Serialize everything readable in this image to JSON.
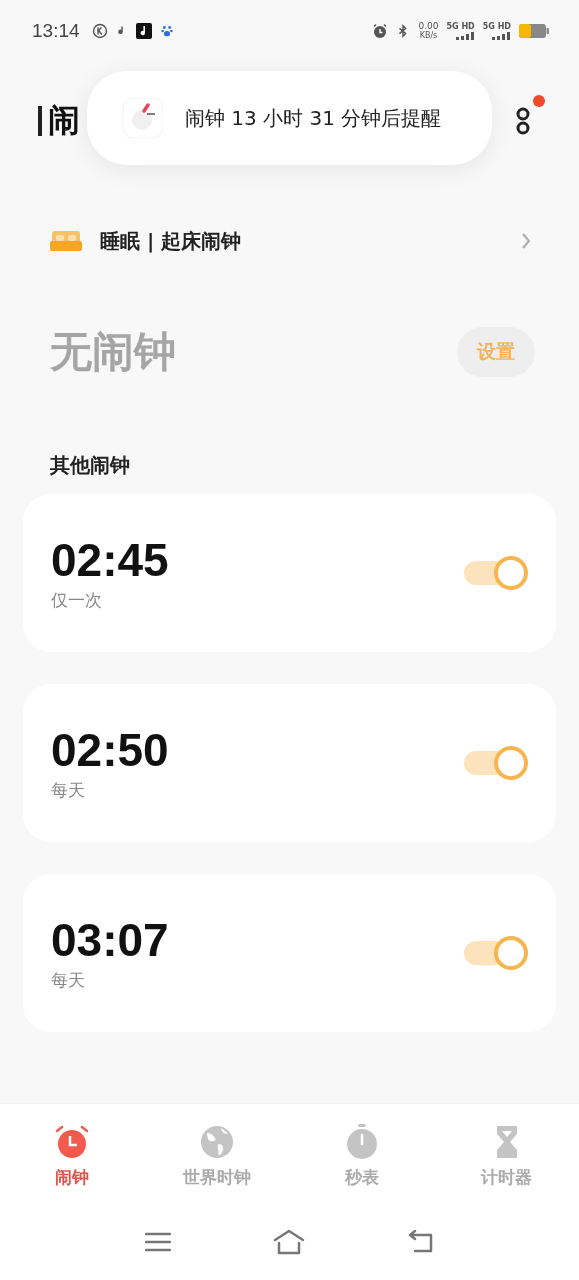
{
  "status_bar": {
    "time": "13:14",
    "net_speed": "0.00",
    "net_unit": "KB/s",
    "sim_labels": [
      "5G HD",
      "5G HD"
    ]
  },
  "header": {
    "title": "闹"
  },
  "toast": {
    "text": "闹钟 13 小时 31 分钟后提醒"
  },
  "menu": {
    "badge": true
  },
  "sleep": {
    "label": "睡眠 | 起床闹钟"
  },
  "main_alarm": {
    "text": "无闹钟",
    "button": "设置"
  },
  "section_title": "其他闹钟",
  "alarms": [
    {
      "time": "02:45",
      "repeat": "仅一次",
      "on": true
    },
    {
      "time": "02:50",
      "repeat": "每天",
      "on": true
    },
    {
      "time": "03:07",
      "repeat": "每天",
      "on": true
    }
  ],
  "tabs": [
    {
      "label": "闹钟",
      "kind": "alarm",
      "selected": true
    },
    {
      "label": "世界时钟",
      "kind": "globe",
      "selected": false
    },
    {
      "label": "秒表",
      "kind": "stopwatch",
      "selected": false
    },
    {
      "label": "计时器",
      "kind": "hourglass",
      "selected": false
    }
  ]
}
